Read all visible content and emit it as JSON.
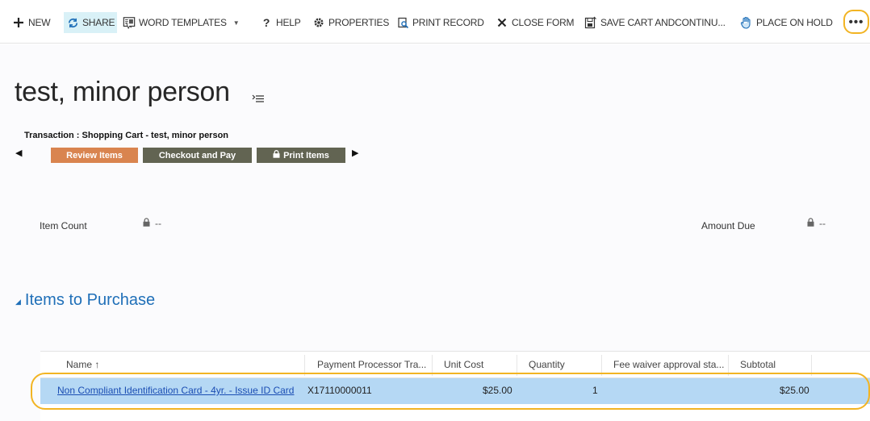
{
  "toolbar": {
    "new_label": "NEW",
    "share_label": "SHARE",
    "word_templates_label": "WORD TEMPLATES",
    "help_label": "HELP",
    "properties_label": "PROPERTIES",
    "print_record_label": "PRINT RECORD",
    "close_form_label": "CLOSE FORM",
    "save_cart_label": "SAVE CART ANDCONTINU...",
    "place_on_hold_label": "PLACE ON HOLD",
    "more_label": "•••"
  },
  "record": {
    "title": "test, minor person",
    "transaction_label": "Transaction : Shopping Cart - test, minor person"
  },
  "stages": {
    "review": "Review Items",
    "checkout": "Checkout and Pay",
    "print": "Print Items"
  },
  "fields": {
    "item_count_label": "Item Count",
    "item_count_value": "--",
    "amount_due_label": "Amount Due",
    "amount_due_value": "--"
  },
  "section": {
    "title": "Items to Purchase"
  },
  "grid": {
    "columns": [
      "Name ↑",
      "Payment Processor Tra...",
      "Unit Cost",
      "Quantity",
      "Fee waiver approval sta...",
      "Subtotal"
    ],
    "rows": [
      {
        "name": "Non Compliant Identification Card - 4yr. - Issue ID Card",
        "payment_processor": "X17110000011",
        "unit_cost": "$25.00",
        "quantity": "1",
        "fee_waiver": "",
        "subtotal": "$25.00"
      }
    ]
  },
  "colors": {
    "highlight_ring": "#f2b423",
    "stage_active": "#d9844f",
    "stage_inactive": "#626452",
    "selected_row": "#b5d8f4",
    "section_link": "#1f6fb8"
  }
}
